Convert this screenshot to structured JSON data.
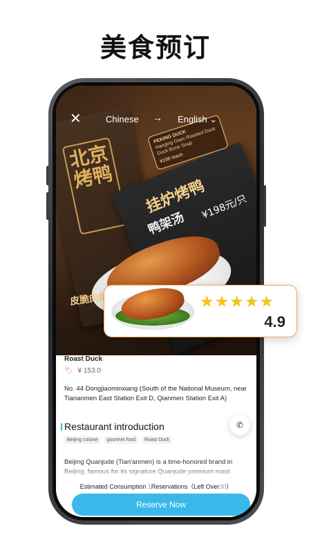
{
  "headline": "美食预订",
  "topbar": {
    "source_lang": "Chinese",
    "target_lang": "English ⌄",
    "arrow": "→",
    "close": "✕"
  },
  "photo": {
    "book_text": "北京烤鸭",
    "menu_title": "挂炉烤鸭",
    "menu_subtitle": "鸭架汤",
    "menu_price": "¥198元/只",
    "crisp_label": "皮脆肉嫩"
  },
  "bubble": {
    "title": "PEKING DUCK",
    "line1": "Hanging Oven Roasted Duck",
    "line2": "Duck Bone Soup",
    "price": "¥198 /each"
  },
  "float_card": {
    "stars": "★★★★★",
    "rating": "4.9"
  },
  "dish": {
    "name": "Roast Duck",
    "price_icon": "🏷",
    "price": "¥ 153.0"
  },
  "address": "No. 44 Dongjiaominxiang (South of the National Museum, near Tiananmen East Station Exit D, Qianmen Station Exit A)",
  "section_title": "Restaurant introduction",
  "phone_icon": "✆",
  "tags": [
    "Beijing cuisine",
    "gourmet food",
    "Roast Duck"
  ],
  "intro": "Beijing Quanjude (Tian'anmen) is a time-honored brand in Beijing, famous for its signature Quanjude premium roast",
  "consume": {
    "label1": "Estimated Consumption",
    "n1": "1",
    "label2": "Reservations（Left Over",
    "n2": "30",
    "close": "）"
  },
  "reserve_button": "Reserve Now",
  "colors": {
    "accent": "#3bb8ea",
    "star": "#f7c21a",
    "card_border": "#f0a54c"
  }
}
